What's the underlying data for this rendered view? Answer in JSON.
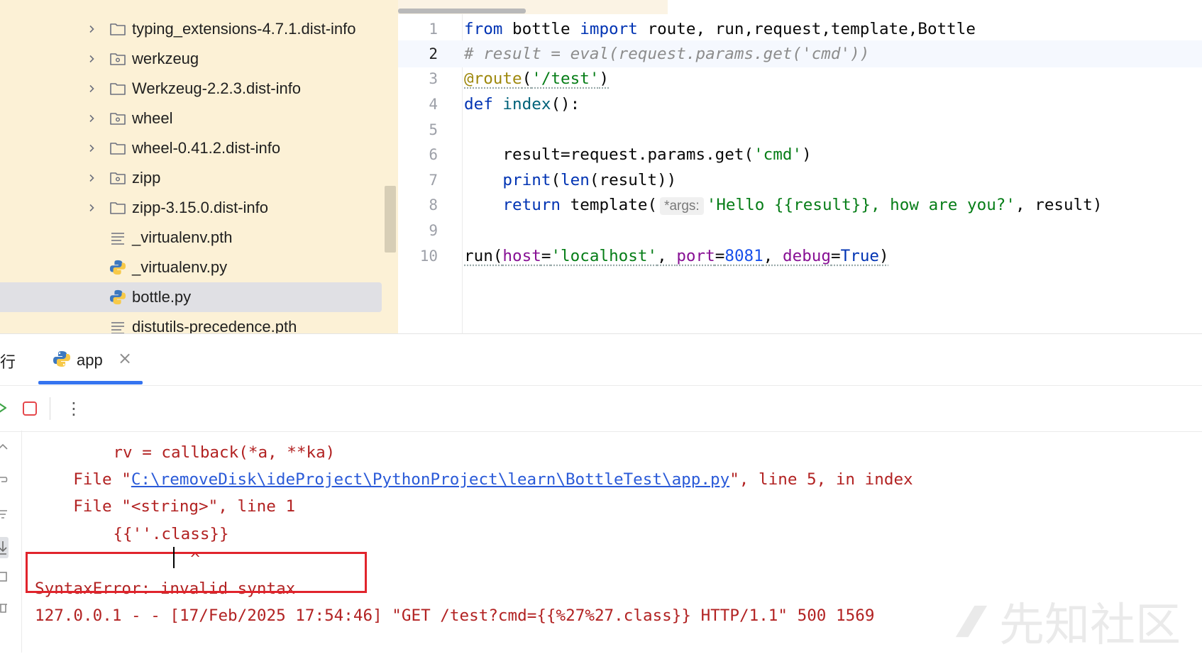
{
  "project_tree": {
    "items": [
      {
        "label": "typing_extensions-4.7.1.dist-info",
        "icon": "folder-icon",
        "expandable": true
      },
      {
        "label": "werkzeug",
        "icon": "package-icon",
        "expandable": true
      },
      {
        "label": "Werkzeug-2.2.3.dist-info",
        "icon": "folder-icon",
        "expandable": true
      },
      {
        "label": "wheel",
        "icon": "package-icon",
        "expandable": true
      },
      {
        "label": "wheel-0.41.2.dist-info",
        "icon": "folder-icon",
        "expandable": true
      },
      {
        "label": "zipp",
        "icon": "package-icon",
        "expandable": true
      },
      {
        "label": "zipp-3.15.0.dist-info",
        "icon": "folder-icon",
        "expandable": true
      },
      {
        "label": "_virtualenv.pth",
        "icon": "text-file-icon",
        "expandable": false
      },
      {
        "label": "_virtualenv.py",
        "icon": "python-file-icon",
        "expandable": false
      },
      {
        "label": "bottle.py",
        "icon": "python-file-icon",
        "expandable": false,
        "selected": true
      },
      {
        "label": "distutils-precedence.pth",
        "icon": "text-file-icon",
        "expandable": false
      }
    ]
  },
  "editor": {
    "current_line": 2,
    "line_numbers": [
      "1",
      "2",
      "3",
      "4",
      "5",
      "6",
      "7",
      "8",
      "9",
      "10"
    ],
    "lines": {
      "l1": {
        "kw1": "from",
        "t1": " bottle ",
        "kw2": "import",
        "t2": " route, run,request,template,Bottle"
      },
      "l2": {
        "comment": "# result = eval(request.params.get('cmd'))"
      },
      "l3": {
        "dec": "@route",
        "t1": "(",
        "str": "'/test'",
        "t2": ")"
      },
      "l4": {
        "kw": "def",
        "t1": " ",
        "fn": "index",
        "t2": "():"
      },
      "l5": {},
      "l6": {
        "t1": "    result=request.params.get(",
        "str": "'cmd'",
        "t2": ")"
      },
      "l7": {
        "t0": "    ",
        "kw": "print",
        "t1": "(",
        "kw2": "len",
        "t2": "(result))"
      },
      "l8": {
        "t0": "    ",
        "kw": "return",
        "t1": " template(",
        "hint": "*args:",
        "str": "'Hello {{result}}, how are you?'",
        "t2": ", result)"
      },
      "l9": {},
      "l10": {
        "t1": "run(",
        "p1": "host",
        "e1": "=",
        "s1": "'localhost'",
        "c1": ", ",
        "p2": "port",
        "e2": "=",
        "n1": "8081",
        "c2": ", ",
        "p3": "debug",
        "e3": "=",
        "k1": "True",
        "t2": ")"
      }
    }
  },
  "run_panel": {
    "title": "运行",
    "tab_label": "app",
    "tab_close": "×",
    "more": "⋮",
    "console": {
      "l1": "    rv = callback(*a, **ka)",
      "l2_pre": "  File \"",
      "l2_link": "C:\\removeDisk\\ideProject\\PythonProject\\learn\\BottleTest\\app.py",
      "l2_post": "\", line 5, in index",
      "l3": "  File \"<string>\", line 1",
      "l4": "    {{''.class}}",
      "l5": "            ^",
      "l6": "SyntaxError: invalid syntax",
      "l7": "127.0.0.1 - - [17/Feb/2025 17:54:46] \"GET /test?cmd={{%27%27.class}} HTTP/1.1\" 500 1569"
    }
  },
  "watermark": "先知社区",
  "colors": {
    "tree_bg": "#fcf1d6",
    "keyword": "#0033b3",
    "string": "#067d17",
    "error_text": "#b22222",
    "highlight_box": "#e1242c",
    "tab_underline": "#3574f0"
  }
}
